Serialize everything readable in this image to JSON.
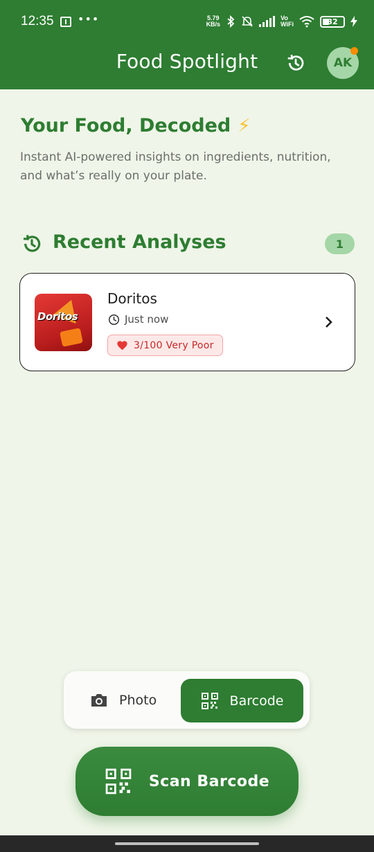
{
  "status_bar": {
    "time": "12:35",
    "more": "•••",
    "net_speed_value": "5.79",
    "net_speed_unit": "KB/s",
    "vowifi_top": "Vo",
    "vowifi_bottom": "WiFi",
    "battery": "32",
    "icons": [
      "sim-icon",
      "bluetooth-icon",
      "mute-icon",
      "signal-icon",
      "wifi-icon",
      "battery-icon",
      "charging-icon"
    ]
  },
  "app_bar": {
    "title": "Food Spotlight",
    "avatar_initials": "AK",
    "avatar_badge_color": "#fb8c00"
  },
  "hero": {
    "title": "Your Food, Decoded",
    "title_emoji": "⚡",
    "subtitle": "Instant AI-powered insights on ingredients, nutrition, and what’s really on your plate."
  },
  "recent": {
    "title": "Recent Analyses",
    "count": "1",
    "items": [
      {
        "name": "Doritos",
        "time": "Just now",
        "score": "3/100 Very Poor",
        "thumb_text": "Doritos"
      }
    ]
  },
  "mode_toggle": {
    "photo_label": "Photo",
    "barcode_label": "Barcode",
    "selected": "Barcode"
  },
  "scan_button": {
    "label": "Scan Barcode"
  },
  "colors": {
    "primary": "#2e7d32",
    "background": "#eff5e8",
    "accent_light": "#a5d6a7",
    "poor_score": "#c62828"
  }
}
